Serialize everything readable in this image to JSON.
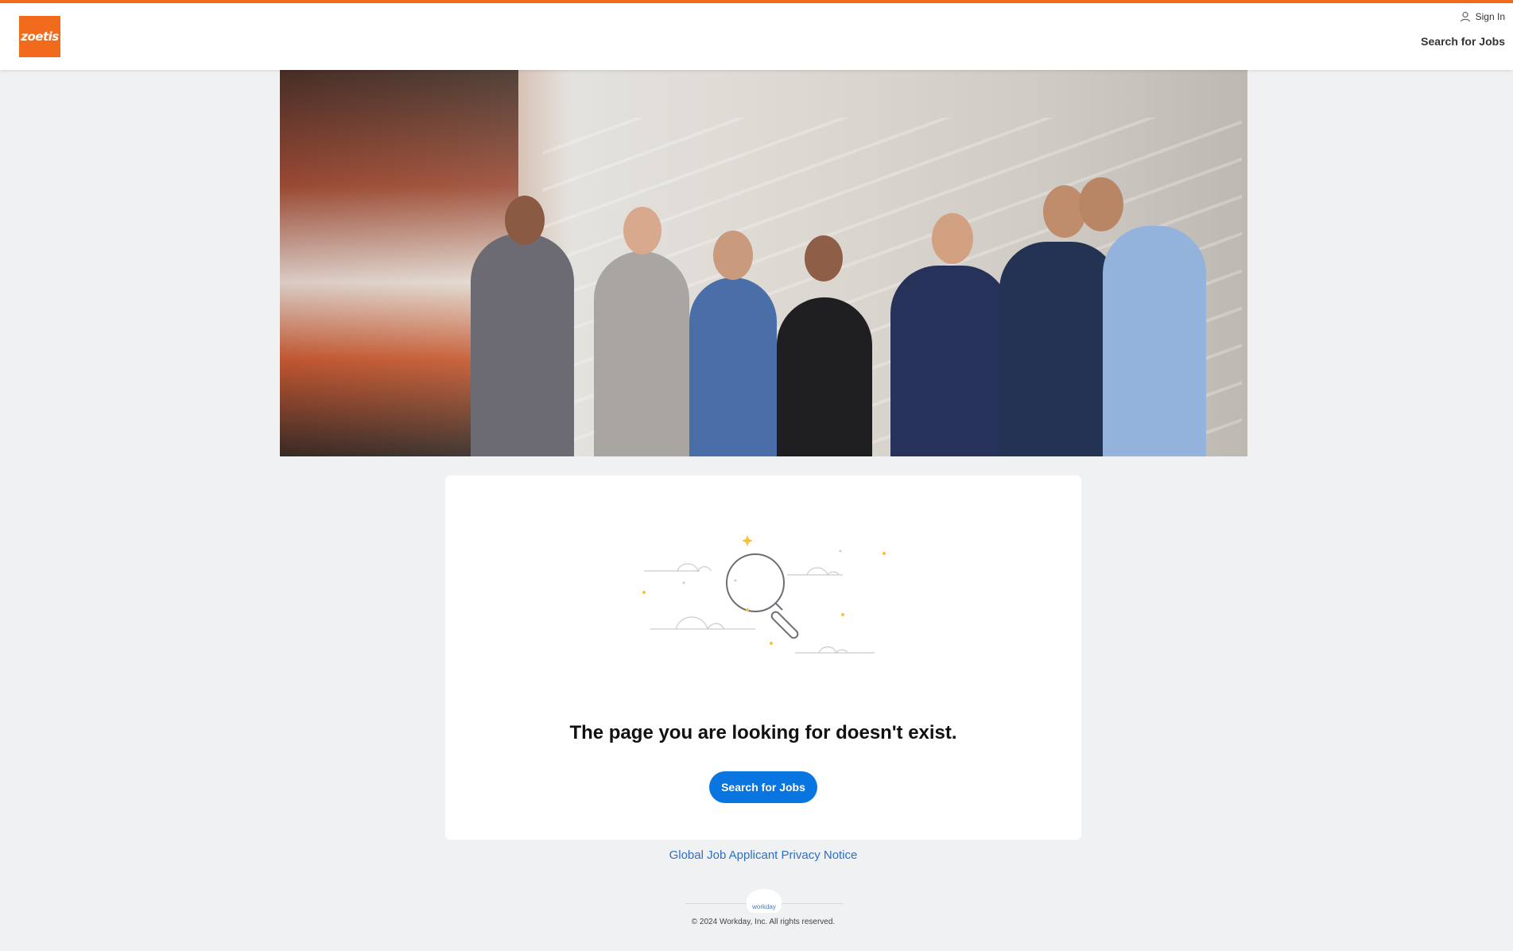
{
  "header": {
    "logo_text": "zoetis",
    "sign_in_label": "Sign In",
    "search_jobs_label": "Search for Jobs"
  },
  "error": {
    "message": "The page you are looking for doesn't exist.",
    "cta_label": "Search for Jobs"
  },
  "footer": {
    "privacy_link": "Global Job Applicant Privacy Notice",
    "badge_text": "workday",
    "copyright": "© 2024 Workday, Inc. All rights reserved."
  },
  "colors": {
    "brand": "#f26b1d",
    "primary_button": "#0875e1",
    "link": "#2f6fbf",
    "page_background": "#f0f1f2"
  },
  "icons": [
    "user-icon",
    "magnifier-illustration",
    "workday-logo"
  ]
}
